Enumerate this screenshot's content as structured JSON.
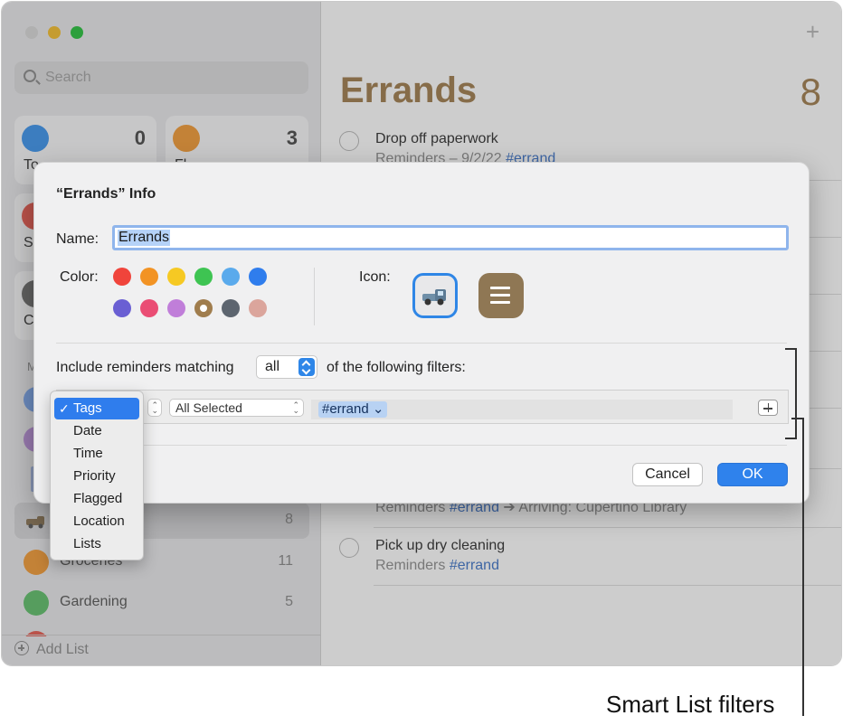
{
  "sidebar": {
    "search_placeholder": "Search",
    "smart_tiles": [
      {
        "label": "To",
        "count": "0",
        "color": "#3c93ec"
      },
      {
        "label": "Fl",
        "count": "3",
        "color": "#f29a35"
      },
      {
        "label": "S",
        "color": "#e65a4f"
      },
      {
        "label": "C",
        "color": "#6b6b6b"
      }
    ],
    "section_label": "M",
    "lists": [
      {
        "name": "",
        "count": "8",
        "color": "#8a7555"
      },
      {
        "name": "Groceries",
        "count": "11",
        "color": "#f29a35"
      },
      {
        "name": "Gardening",
        "count": "5",
        "color": "#5fbf6a"
      }
    ],
    "add_list_label": "Add List"
  },
  "main": {
    "title": "Errands",
    "count": "8",
    "plus_label": "+",
    "reminders": [
      {
        "title": "Drop off paperwork",
        "sub_prefix": "Reminders – 9/2/22",
        "tag": "#errand"
      },
      {
        "title": "",
        "sub_prefix": "Reminders",
        "tag": "#errand",
        "sub_suffix": "➔ Arriving: Cupertino Library"
      },
      {
        "title": "Pick up dry cleaning",
        "sub_prefix": "Reminders",
        "tag": "#errand"
      }
    ]
  },
  "dialog": {
    "title": "“Errands” Info",
    "name_label": "Name:",
    "name_value": "Errands",
    "color_label": "Color:",
    "icon_label": "Icon:",
    "colors": [
      "#f0443b",
      "#f29324",
      "#f6c923",
      "#3ec452",
      "#5aaaec",
      "#2f7ded",
      "#6a5fd3",
      "#ea4d74",
      "#c07ed9",
      "#a07d4d",
      "#5d656f",
      "#dba59c"
    ],
    "include_prefix": "Include reminders matching",
    "match_value": "all",
    "include_suffix": "of the following filters:",
    "tag_selector_value": "All Selected",
    "token_value": "#errand ⌄",
    "cancel_label": "Cancel",
    "ok_label": "OK"
  },
  "filter_menu": {
    "items": [
      "Tags",
      "Date",
      "Time",
      "Priority",
      "Flagged",
      "Location",
      "Lists"
    ],
    "selected": "Tags",
    "check": "✓"
  },
  "callout": {
    "label": "Smart List filters"
  }
}
